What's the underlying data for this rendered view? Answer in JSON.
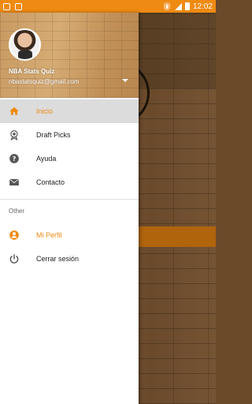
{
  "status_bar": {
    "time": "12:02"
  },
  "drawer": {
    "header": {
      "app_name": "NBA Stats Quiz",
      "email": "nbastatsquiz@gmail.com"
    },
    "items": [
      {
        "label": "Inicio",
        "icon": "home-icon",
        "active": true
      },
      {
        "label": "Draft Picks",
        "icon": "draft-badge-icon",
        "active": false
      },
      {
        "label": "Ayuda",
        "icon": "help-icon",
        "active": false
      },
      {
        "label": "Contacto",
        "icon": "mail-icon",
        "active": false
      }
    ],
    "other_section": {
      "title": "Other",
      "items": [
        {
          "label": "Mi Perfil",
          "icon": "profile-icon"
        },
        {
          "label": "Cerrar sesión",
          "icon": "power-icon"
        }
      ]
    }
  },
  "colors": {
    "accent": "#ef8a12",
    "active_bg": "#dcdcdc"
  }
}
